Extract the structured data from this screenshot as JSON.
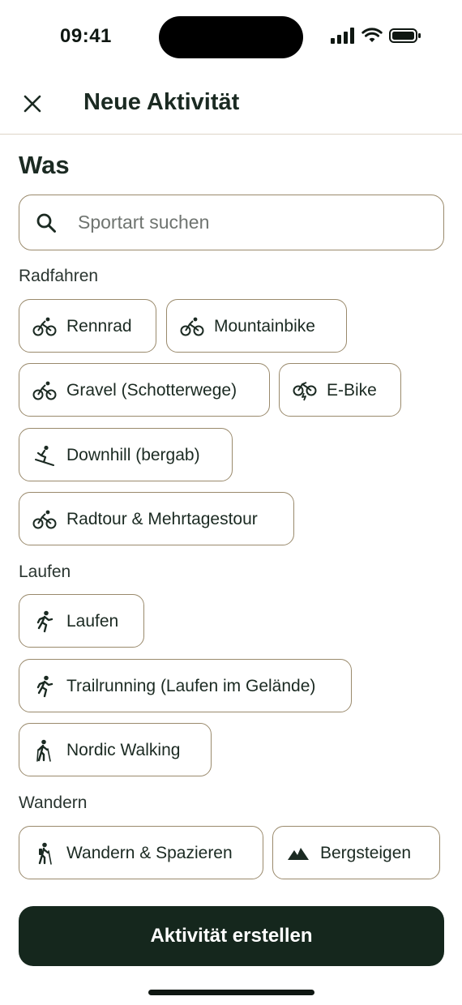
{
  "status": {
    "time": "09:41"
  },
  "header": {
    "title": "Neue Aktivität",
    "close_icon": "close-icon"
  },
  "section": {
    "title": "Was"
  },
  "search": {
    "placeholder": "Sportart suchen",
    "value": ""
  },
  "categories": [
    {
      "label": "Radfahren",
      "chips": [
        {
          "label": "Rennrad",
          "icon": "bike-icon"
        },
        {
          "label": "Mountainbike",
          "icon": "bike-icon"
        },
        {
          "label": "Gravel (Schotterwege)",
          "icon": "bike-icon"
        },
        {
          "label": "E-Bike",
          "icon": "ebike-icon"
        },
        {
          "label": "Downhill (bergab)",
          "icon": "downhill-icon"
        },
        {
          "label": "Radtour & Mehrtagestour",
          "icon": "bike-icon"
        }
      ]
    },
    {
      "label": "Laufen",
      "chips": [
        {
          "label": "Laufen",
          "icon": "run-icon"
        },
        {
          "label": "Trailrunning (Laufen im Gelände)",
          "icon": "run-icon"
        },
        {
          "label": "Nordic Walking",
          "icon": "nordic-walking-icon"
        }
      ]
    },
    {
      "label": "Wandern",
      "chips": [
        {
          "label": "Wandern & Spazieren",
          "icon": "hiking-icon"
        },
        {
          "label": "Bergsteigen",
          "icon": "mountain-icon"
        }
      ]
    }
  ],
  "cta": {
    "label": "Aktivität erstellen"
  },
  "colors": {
    "primary": "#15271d",
    "chip_border": "#9a8a6c",
    "text": "#1b2a22"
  }
}
